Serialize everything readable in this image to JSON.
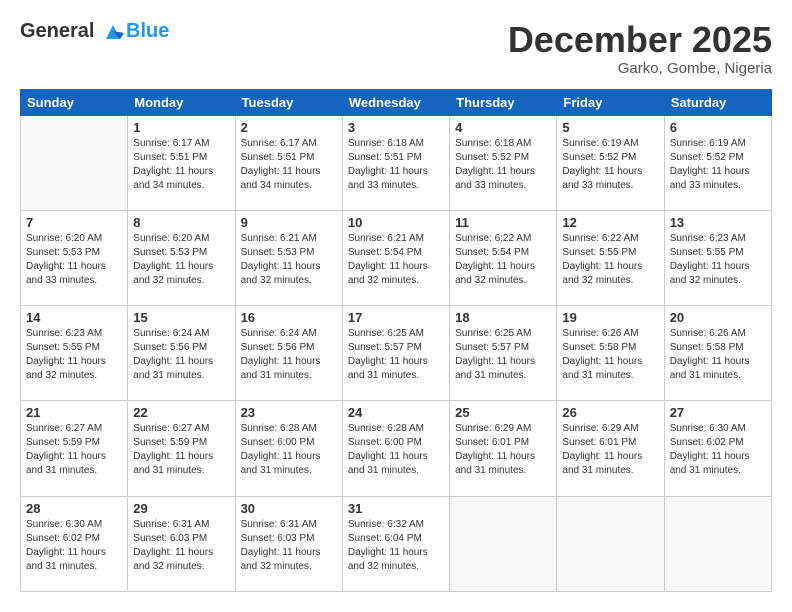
{
  "header": {
    "logo_line1": "General",
    "logo_line2": "Blue",
    "month": "December 2025",
    "location": "Garko, Gombe, Nigeria"
  },
  "days_of_week": [
    "Sunday",
    "Monday",
    "Tuesday",
    "Wednesday",
    "Thursday",
    "Friday",
    "Saturday"
  ],
  "weeks": [
    [
      {
        "day": "",
        "sunrise": "",
        "sunset": "",
        "daylight": ""
      },
      {
        "day": "1",
        "sunrise": "Sunrise: 6:17 AM",
        "sunset": "Sunset: 5:51 PM",
        "daylight": "Daylight: 11 hours and 34 minutes."
      },
      {
        "day": "2",
        "sunrise": "Sunrise: 6:17 AM",
        "sunset": "Sunset: 5:51 PM",
        "daylight": "Daylight: 11 hours and 34 minutes."
      },
      {
        "day": "3",
        "sunrise": "Sunrise: 6:18 AM",
        "sunset": "Sunset: 5:51 PM",
        "daylight": "Daylight: 11 hours and 33 minutes."
      },
      {
        "day": "4",
        "sunrise": "Sunrise: 6:18 AM",
        "sunset": "Sunset: 5:52 PM",
        "daylight": "Daylight: 11 hours and 33 minutes."
      },
      {
        "day": "5",
        "sunrise": "Sunrise: 6:19 AM",
        "sunset": "Sunset: 5:52 PM",
        "daylight": "Daylight: 11 hours and 33 minutes."
      },
      {
        "day": "6",
        "sunrise": "Sunrise: 6:19 AM",
        "sunset": "Sunset: 5:52 PM",
        "daylight": "Daylight: 11 hours and 33 minutes."
      }
    ],
    [
      {
        "day": "7",
        "sunrise": "Sunrise: 6:20 AM",
        "sunset": "Sunset: 5:53 PM",
        "daylight": "Daylight: 11 hours and 33 minutes."
      },
      {
        "day": "8",
        "sunrise": "Sunrise: 6:20 AM",
        "sunset": "Sunset: 5:53 PM",
        "daylight": "Daylight: 11 hours and 32 minutes."
      },
      {
        "day": "9",
        "sunrise": "Sunrise: 6:21 AM",
        "sunset": "Sunset: 5:53 PM",
        "daylight": "Daylight: 11 hours and 32 minutes."
      },
      {
        "day": "10",
        "sunrise": "Sunrise: 6:21 AM",
        "sunset": "Sunset: 5:54 PM",
        "daylight": "Daylight: 11 hours and 32 minutes."
      },
      {
        "day": "11",
        "sunrise": "Sunrise: 6:22 AM",
        "sunset": "Sunset: 5:54 PM",
        "daylight": "Daylight: 11 hours and 32 minutes."
      },
      {
        "day": "12",
        "sunrise": "Sunrise: 6:22 AM",
        "sunset": "Sunset: 5:55 PM",
        "daylight": "Daylight: 11 hours and 32 minutes."
      },
      {
        "day": "13",
        "sunrise": "Sunrise: 6:23 AM",
        "sunset": "Sunset: 5:55 PM",
        "daylight": "Daylight: 11 hours and 32 minutes."
      }
    ],
    [
      {
        "day": "14",
        "sunrise": "Sunrise: 6:23 AM",
        "sunset": "Sunset: 5:55 PM",
        "daylight": "Daylight: 11 hours and 32 minutes."
      },
      {
        "day": "15",
        "sunrise": "Sunrise: 6:24 AM",
        "sunset": "Sunset: 5:56 PM",
        "daylight": "Daylight: 11 hours and 31 minutes."
      },
      {
        "day": "16",
        "sunrise": "Sunrise: 6:24 AM",
        "sunset": "Sunset: 5:56 PM",
        "daylight": "Daylight: 11 hours and 31 minutes."
      },
      {
        "day": "17",
        "sunrise": "Sunrise: 6:25 AM",
        "sunset": "Sunset: 5:57 PM",
        "daylight": "Daylight: 11 hours and 31 minutes."
      },
      {
        "day": "18",
        "sunrise": "Sunrise: 6:25 AM",
        "sunset": "Sunset: 5:57 PM",
        "daylight": "Daylight: 11 hours and 31 minutes."
      },
      {
        "day": "19",
        "sunrise": "Sunrise: 6:26 AM",
        "sunset": "Sunset: 5:58 PM",
        "daylight": "Daylight: 11 hours and 31 minutes."
      },
      {
        "day": "20",
        "sunrise": "Sunrise: 6:26 AM",
        "sunset": "Sunset: 5:58 PM",
        "daylight": "Daylight: 11 hours and 31 minutes."
      }
    ],
    [
      {
        "day": "21",
        "sunrise": "Sunrise: 6:27 AM",
        "sunset": "Sunset: 5:59 PM",
        "daylight": "Daylight: 11 hours and 31 minutes."
      },
      {
        "day": "22",
        "sunrise": "Sunrise: 6:27 AM",
        "sunset": "Sunset: 5:59 PM",
        "daylight": "Daylight: 11 hours and 31 minutes."
      },
      {
        "day": "23",
        "sunrise": "Sunrise: 6:28 AM",
        "sunset": "Sunset: 6:00 PM",
        "daylight": "Daylight: 11 hours and 31 minutes."
      },
      {
        "day": "24",
        "sunrise": "Sunrise: 6:28 AM",
        "sunset": "Sunset: 6:00 PM",
        "daylight": "Daylight: 11 hours and 31 minutes."
      },
      {
        "day": "25",
        "sunrise": "Sunrise: 6:29 AM",
        "sunset": "Sunset: 6:01 PM",
        "daylight": "Daylight: 11 hours and 31 minutes."
      },
      {
        "day": "26",
        "sunrise": "Sunrise: 6:29 AM",
        "sunset": "Sunset: 6:01 PM",
        "daylight": "Daylight: 11 hours and 31 minutes."
      },
      {
        "day": "27",
        "sunrise": "Sunrise: 6:30 AM",
        "sunset": "Sunset: 6:02 PM",
        "daylight": "Daylight: 11 hours and 31 minutes."
      }
    ],
    [
      {
        "day": "28",
        "sunrise": "Sunrise: 6:30 AM",
        "sunset": "Sunset: 6:02 PM",
        "daylight": "Daylight: 11 hours and 31 minutes."
      },
      {
        "day": "29",
        "sunrise": "Sunrise: 6:31 AM",
        "sunset": "Sunset: 6:03 PM",
        "daylight": "Daylight: 11 hours and 32 minutes."
      },
      {
        "day": "30",
        "sunrise": "Sunrise: 6:31 AM",
        "sunset": "Sunset: 6:03 PM",
        "daylight": "Daylight: 11 hours and 32 minutes."
      },
      {
        "day": "31",
        "sunrise": "Sunrise: 6:32 AM",
        "sunset": "Sunset: 6:04 PM",
        "daylight": "Daylight: 11 hours and 32 minutes."
      },
      {
        "day": "",
        "sunrise": "",
        "sunset": "",
        "daylight": ""
      },
      {
        "day": "",
        "sunrise": "",
        "sunset": "",
        "daylight": ""
      },
      {
        "day": "",
        "sunrise": "",
        "sunset": "",
        "daylight": ""
      }
    ]
  ]
}
